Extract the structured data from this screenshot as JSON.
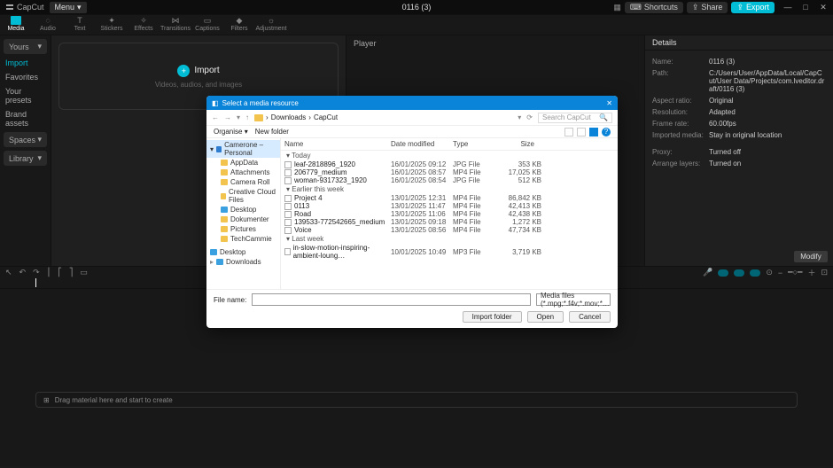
{
  "app": {
    "brand": "CapCut",
    "menu": "Menu",
    "title": "0116 (3)"
  },
  "topbar": {
    "shortcuts": "Shortcuts",
    "share": "Share",
    "export": "Export"
  },
  "tools": [
    "Media",
    "Audio",
    "Text",
    "Stickers",
    "Effects",
    "Transitions",
    "Captions",
    "Filters",
    "Adjustment"
  ],
  "left": {
    "yours": "Yours",
    "import": "Import",
    "favorites": "Favorites",
    "presets": "Your presets",
    "brand": "Brand assets",
    "spaces": "Spaces",
    "library": "Library"
  },
  "importcard": {
    "label": "Import",
    "sub": "Videos, audios, and images"
  },
  "player": {
    "label": "Player"
  },
  "details": {
    "title": "Details",
    "rows": {
      "name_k": "Name:",
      "name_v": "0116 (3)",
      "path_k": "Path:",
      "path_v": "C:/Users/User/AppData/Local/CapCut/User Data/Projects/com.lveditor.draft/0116 (3)",
      "aspect_k": "Aspect ratio:",
      "aspect_v": "Original",
      "res_k": "Resolution:",
      "res_v": "Adapted",
      "fr_k": "Frame rate:",
      "fr_v": "60.00fps",
      "imp_k": "Imported media:",
      "imp_v": "Stay in original location",
      "proxy_k": "Proxy:",
      "proxy_v": "Turned off",
      "arr_k": "Arrange layers:",
      "arr_v": "Turned on"
    },
    "modify": "Modify"
  },
  "timeline": {
    "dragmsg": "Drag material here and start to create"
  },
  "dialog": {
    "title": "Select a media resource",
    "crumbA": "Downloads",
    "crumbB": "CapCut",
    "search_ph": "Search CapCut",
    "organise": "Organise",
    "newfolder": "New folder",
    "tree": [
      "Camerone – Personal",
      "AppData",
      "Attachments",
      "Camera Roll",
      "Creative Cloud Files",
      "Desktop",
      "Dokumenter",
      "Pictures",
      "TechCammie",
      "Desktop",
      "Downloads"
    ],
    "cols": {
      "name": "Name",
      "date": "Date modified",
      "type": "Type",
      "size": "Size"
    },
    "groups": {
      "today": "Today",
      "earlier": "Earlier this week",
      "lastweek": "Last week"
    },
    "files": {
      "today": [
        {
          "n": "leaf-2818896_1920",
          "d": "16/01/2025 09:12",
          "t": "JPG File",
          "s": "353 KB"
        },
        {
          "n": "206779_medium",
          "d": "16/01/2025 08:57",
          "t": "MP4 File",
          "s": "17,025 KB"
        },
        {
          "n": "woman-9317323_1920",
          "d": "16/01/2025 08:54",
          "t": "JPG File",
          "s": "512 KB"
        }
      ],
      "earlier": [
        {
          "n": "Project 4",
          "d": "13/01/2025 12:31",
          "t": "MP4 File",
          "s": "86,842 KB"
        },
        {
          "n": "0113",
          "d": "13/01/2025 11:47",
          "t": "MP4 File",
          "s": "42,413 KB"
        },
        {
          "n": "Road",
          "d": "13/01/2025 11:06",
          "t": "MP4 File",
          "s": "42,438 KB"
        },
        {
          "n": "139533-772542665_medium",
          "d": "13/01/2025 09:18",
          "t": "MP4 File",
          "s": "1,272 KB"
        },
        {
          "n": "Voice",
          "d": "13/01/2025 08:56",
          "t": "MP4 File",
          "s": "47,734 KB"
        }
      ],
      "lastweek": [
        {
          "n": "in-slow-motion-inspiring-ambient-loung…",
          "d": "10/01/2025 10:49",
          "t": "MP3 File",
          "s": "3,719 KB"
        }
      ]
    },
    "filename_label": "File name:",
    "filter": "Media files (*.mpg;*.f4v;*.mov;*…",
    "import_folder": "Import folder",
    "open": "Open",
    "cancel": "Cancel"
  }
}
